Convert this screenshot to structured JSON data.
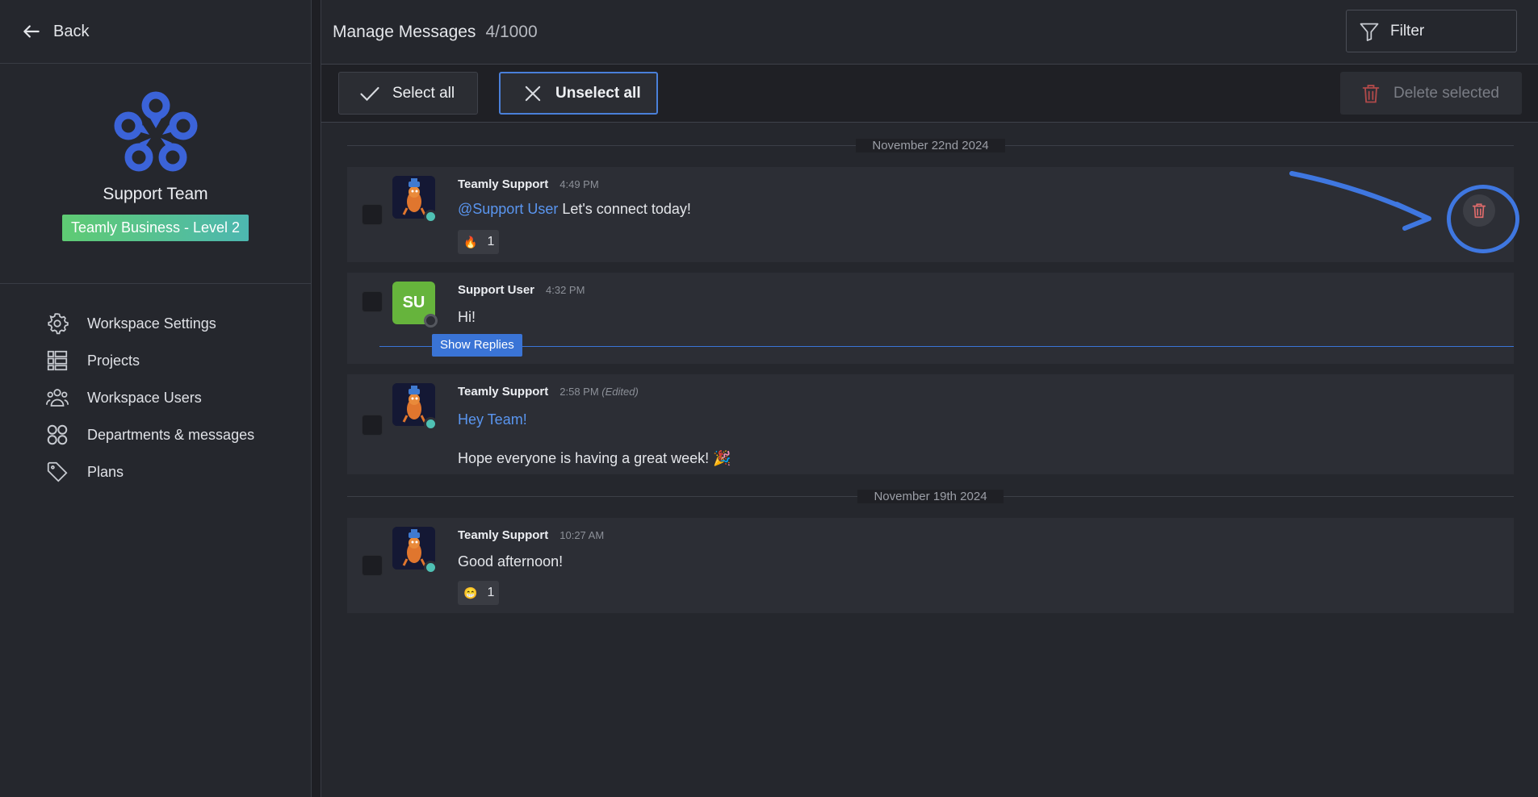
{
  "sidebar": {
    "back_label": "Back",
    "team_name": "Support Team",
    "plan_badge": "Teamly Business - Level 2",
    "nav": [
      {
        "label": "Workspace Settings",
        "icon": "gear-icon"
      },
      {
        "label": "Projects",
        "icon": "list-icon"
      },
      {
        "label": "Workspace Users",
        "icon": "users-icon"
      },
      {
        "label": "Departments & messages",
        "icon": "grid-icon"
      },
      {
        "label": "Plans",
        "icon": "tag-icon"
      }
    ]
  },
  "header": {
    "title": "Manage Messages",
    "count": "4/1000",
    "filter_label": "Filter"
  },
  "actions": {
    "select_all": "Select all",
    "unselect_all": "Unselect all",
    "delete_selected": "Delete selected"
  },
  "feed": {
    "dates": [
      "November 22nd 2024",
      "November 19th 2024"
    ],
    "messages": [
      {
        "author": "Teamly Support",
        "time": "4:49 PM",
        "mention": "@Support User",
        "text": "Let's connect today!",
        "reaction": {
          "emoji": "🔥",
          "count": "1"
        }
      },
      {
        "author": "Support User",
        "initials": "SU",
        "time": "4:32 PM",
        "text": "Hi!",
        "show_replies": "Show Replies"
      },
      {
        "author": "Teamly Support",
        "time": "2:58 PM",
        "edited": "(Edited)",
        "text_line1": "Hey Team!",
        "text_line2": "Hope everyone is having a great week! 🎉"
      },
      {
        "author": "Teamly Support",
        "time": "10:27 AM",
        "text": "Good afternoon!",
        "reaction": {
          "emoji": "😁",
          "count": "1"
        }
      }
    ]
  },
  "colors": {
    "accent": "#4a80d9",
    "mention": "#5a96f0",
    "online": "#4fc1b4",
    "badge_start": "#5fcb73",
    "badge_end": "#4db7b0",
    "annotation": "#3f77e0"
  }
}
